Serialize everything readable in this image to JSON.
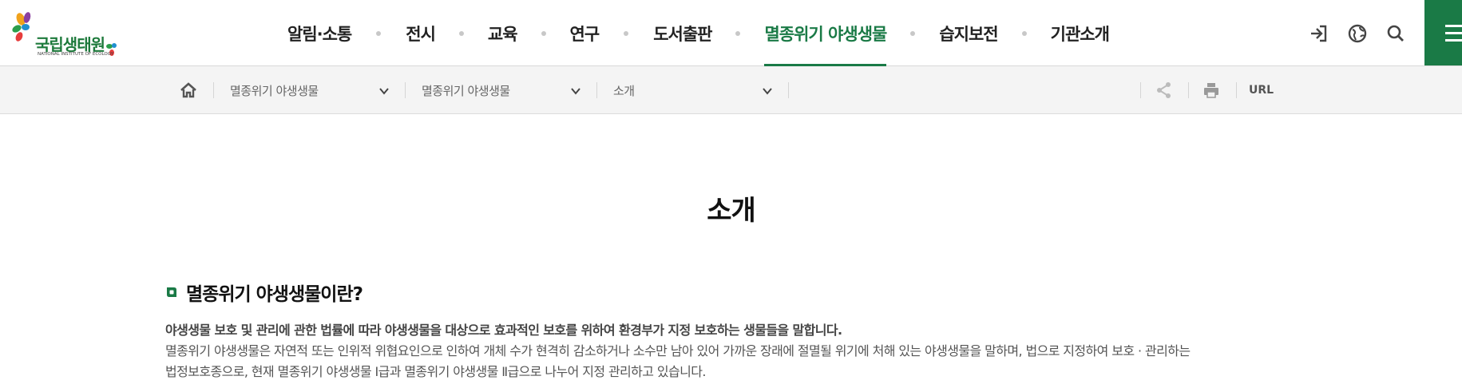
{
  "logo": {
    "name": "국립생태원",
    "subname": "NATIONAL INSTITUTE OF ECOLOGY"
  },
  "gnb": {
    "items": [
      {
        "label": "알림·소통"
      },
      {
        "label": "전시"
      },
      {
        "label": "교육"
      },
      {
        "label": "연구"
      },
      {
        "label": "도서출판"
      },
      {
        "label": "멸종위기 야생생물",
        "active": true
      },
      {
        "label": "습지보전"
      },
      {
        "label": "기관소개"
      }
    ]
  },
  "utility": {
    "icons": [
      "login-icon",
      "globe-icon",
      "search-icon",
      "menu-icon"
    ]
  },
  "colors": {
    "accent": "#1a7a46",
    "locbar_bg": "#f4f4f4"
  },
  "location": {
    "depth1": "멸종위기 야생생물",
    "depth2": "멸종위기 야생생물",
    "depth3": "소개",
    "url_label": "URL"
  },
  "content": {
    "title": "소개",
    "section_title": "멸종위기 야생생물이란?",
    "para_bold": "야생생물 보호 및 관리에 관한 법률에 따라 야생생물을 대상으로 효과적인 보호를 위하여 환경부가 지정 보호하는 생물들을 말합니다.",
    "para_line1": "멸종위기 야생생물은 자연적 또는 인위적 위협요인으로 인하여 개체 수가 현격히 감소하거나 소수만 남아 있어 가까운 장래에 절멸될 위기에 처해 있는 야생생물을 말하며, 법으로 지정하여 보호 · 관리하는",
    "para_line2": "법정보호종으로, 현재 멸종위기 야생생물 Ⅰ급과 멸종위기 야생생물 Ⅱ급으로 나누어 지정 관리하고 있습니다."
  }
}
